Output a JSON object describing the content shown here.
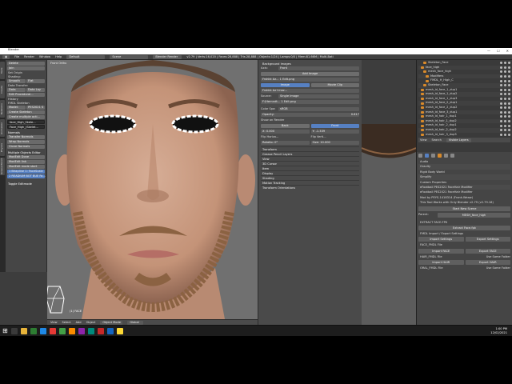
{
  "window": {
    "title": "Blender",
    "controls": [
      "—",
      "☐",
      "✕"
    ]
  },
  "menubar": {
    "items": [
      "File",
      "Render",
      "Window",
      "Help"
    ],
    "layout": "Default",
    "scene": "Scene",
    "engine": "Blender Render",
    "stats": "v2.79 | Verts:16,020 | Faces:28,888 | Tris:28,888 | Objects:1/24 | Lamps:0/0 | Mem:81.66M | Multi-Bati"
  },
  "toolshelf": {
    "tabs": [
      "Tools",
      "Create",
      "Relations",
      "Animation",
      "Physics",
      "Grease Pencil"
    ],
    "items": [
      {
        "t": "btn",
        "v": "Delete"
      },
      {
        "t": "btn",
        "v": "Join"
      },
      {
        "t": "label",
        "v": "Set Origin"
      },
      {
        "t": "label",
        "v": "Shading:"
      },
      {
        "t": "split",
        "v": [
          "Smooth",
          "Flat"
        ]
      },
      {
        "t": "label",
        "v": "Data Transfer:"
      },
      {
        "t": "split",
        "v": [
          "Data",
          "Data Lay"
        ]
      },
      {
        "t": "btn",
        "v": "Edit Procedural..."
      },
      {
        "t": "label",
        "v": "History"
      },
      {
        "t": "label",
        "v": "FMDL Skeleton"
      },
      {
        "t": "split",
        "v": [
          "Model:",
          "PES2021 S"
        ]
      },
      {
        "t": "btn",
        "v": "Create Skeleton"
      },
      {
        "t": "btn",
        "v": "Create multiple acti..."
      },
      {
        "t": "dark",
        "v": "face_High_Skele..."
      },
      {
        "t": "dark",
        "v": "Face_High_(Skelet..."
      }
    ],
    "normals_head": "Normals",
    "normals": [
      "Transfer Normals",
      "Wrap Normals",
      "Clone Normals"
    ],
    "multi_head": "Multiple Objects Editor",
    "multi": [
      "ModEdit Done",
      "ModEdit link",
      "ModEdit mode start"
    ],
    "selected_items": [
      "1 Bhapline 1: FaceScale",
      "2 READIUM BOT BUE Fa..."
    ],
    "toggle": "Toggle Editmode"
  },
  "viewport": {
    "label": "Front Ortho",
    "object_label": "(1) FACE"
  },
  "viewport_header": {
    "items": [
      "View",
      "Select",
      "Add",
      "Object",
      "Object Mode",
      "Global"
    ]
  },
  "npanel": {
    "bg_head": "Background Images",
    "axis_label": "Axis:",
    "axis_val": "Front",
    "add_image": "Add Image",
    "image_label": "Frshkk Az... 1 Edit.png",
    "img_tabs": [
      "Image",
      "Movie Clip"
    ],
    "img_name": "Frshkk Az+maz...",
    "source_label": "Source:",
    "source_val": "Single Image",
    "file_path": "F:\\Hernndt... 1 Edit.png",
    "color_space_label": "Color Spa:",
    "color_space_val": "sRGB",
    "opacity_label": "Opacity:",
    "opacity_val": "0.617",
    "show_expanded": "Show on Render",
    "toggles": [
      "Back",
      "Front"
    ],
    "x_label": "X: 0.000",
    "y_label": "Y: -1.339",
    "flip_h": "Flip Horizo...",
    "flip_v": "Flip Verti...",
    "rotation": "Rotatio: 0°",
    "size": "Size: 10.000",
    "sections": [
      "Transform",
      "Grease Pencil Layers",
      "View",
      "3D Cursor",
      "Item",
      "Display",
      "Shading",
      "Motion Tracking",
      "Transform Orientations"
    ]
  },
  "outliner": {
    "rows": [
      {
        "n": "Skeleton_Face",
        "i": 2
      },
      {
        "n": "face_high",
        "i": 1
      },
      {
        "n": "mesh_face_high",
        "i": 2
      },
      {
        "n": "Modifiers",
        "i": 3
      },
      {
        "n": "FMDL_H_High_C",
        "i": 3
      },
      {
        "n": "Skeleton_Face",
        "i": 2
      },
      {
        "n": "mesh_id_face_1_dup1",
        "i": 1
      },
      {
        "n": "mesh_id_face_1_dup2",
        "i": 1
      },
      {
        "n": "mesh_id_face_1_dup3",
        "i": 1
      },
      {
        "n": "mesh_id_face_2_dup1",
        "i": 1
      },
      {
        "n": "mesh_id_face_2_dup2",
        "i": 1
      },
      {
        "n": "mesh_id_face_3_dup1",
        "i": 1
      },
      {
        "n": "mesh_id_hair_1_dup1",
        "i": 1
      },
      {
        "n": "mesh_id_hair_1_dup2",
        "i": 1
      },
      {
        "n": "mesh_id_hair_2_dup1",
        "i": 1
      },
      {
        "n": "mesh_id_hair_2_dup2",
        "i": 1
      },
      {
        "n": "mesh_id_hair_3_dup3",
        "i": 1
      }
    ],
    "footer": [
      "View",
      "Search",
      "Visible Layers"
    ]
  },
  "properties": {
    "rows": [
      "Audio",
      "Gravity",
      "Rigid Body World",
      "Simplify",
      "Custom Properties",
      "eFootball PES2021 FaceHair Modifier"
    ],
    "version_line": "eFootball PES2021 FaceHair Modifier",
    "mod_by": "Mod by PEYS-1418314 (Frank.Weaw)",
    "warning": "This Tool Works with Only Blender v2.79 (v2.79.16)",
    "start_btn": "Start New Scene",
    "parent_label": "Parent:",
    "parent_val": "MESH_face_high",
    "extract_head": "EXTRACT FACE.FPK",
    "extract_btn": "Extract Face.fpk",
    "fmdl_head": "FMDL Import / Export Settings",
    "import_settings": "Import Settings",
    "export_settings": "Export Settings",
    "face_head": "FACE_FMDL File",
    "import_face": "Import FACE",
    "export_face": "Export FACE",
    "hair_head": "HAIR_FMDL File",
    "use_same": "Use Same Folder",
    "import_hair": "Import HAIR",
    "export_hair": "Export HAIR",
    "oral_head": "ORAL_FMDL File",
    "use_same2": "Use Same Folder"
  },
  "taskbar": {
    "time": "1:00 PM",
    "date": "12/02/2021"
  },
  "colors": {
    "accent": "#5680c2",
    "skin": "#c9a089",
    "beard": "#8b6242"
  }
}
